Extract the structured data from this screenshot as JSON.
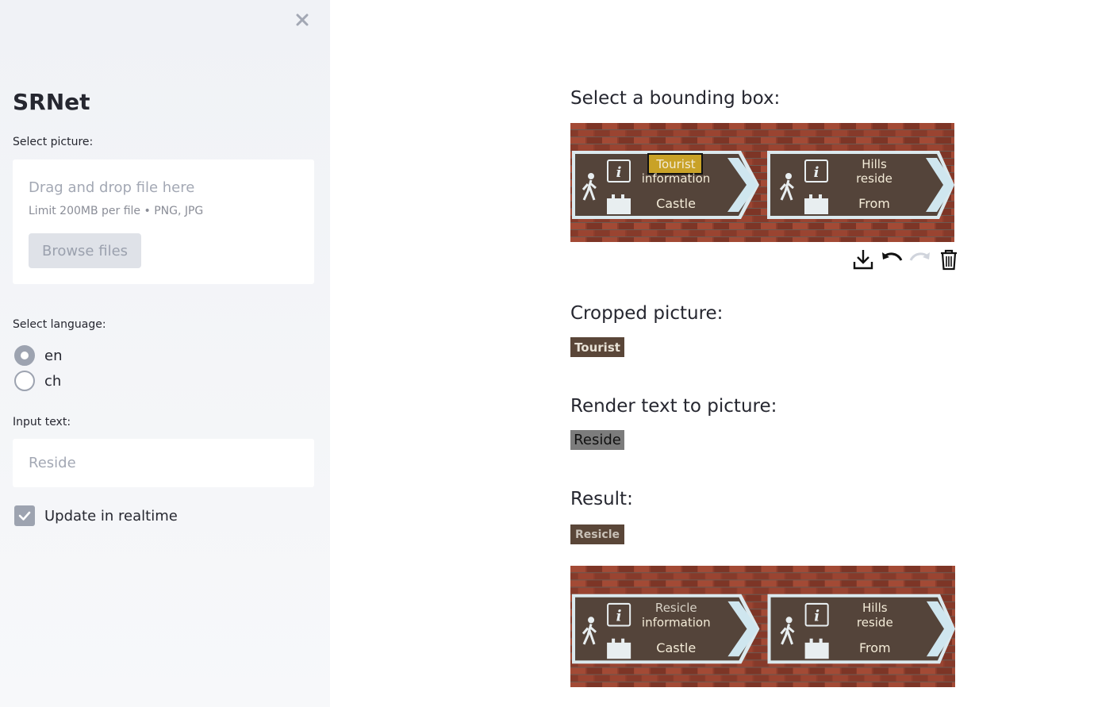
{
  "sidebar": {
    "title": "SRNet",
    "picture_label": "Select picture:",
    "dropzone": {
      "text": "Drag and drop file here",
      "limit": "Limit 200MB per file • PNG, JPG",
      "browse_label": "Browse files"
    },
    "language_label": "Select language:",
    "languages": [
      {
        "label": "en",
        "selected": true
      },
      {
        "label": "ch",
        "selected": false
      }
    ],
    "input_label": "Input text:",
    "input_placeholder": "Reside",
    "realtime_label": "Update in realtime",
    "realtime_checked": true
  },
  "main": {
    "bbox_heading": "Select a bounding box:",
    "cropped_heading": "Cropped picture:",
    "cropped_text": "Tourist",
    "render_heading": "Render text to picture:",
    "render_text": "Reside",
    "result_heading": "Result:",
    "result_text": "Resicle",
    "original_sign": {
      "left_line1": "Tourist",
      "left_line2": "information",
      "left_line3": "Castle",
      "right_line1": "Hills",
      "right_line2": "reside",
      "right_line3": "From"
    },
    "result_sign": {
      "left_line1": "Resicle",
      "left_line2": "information",
      "left_line3": "Castle",
      "right_line1": "Hills",
      "right_line2": "reside",
      "right_line3": "From"
    },
    "toolbar_icons": [
      "download-icon",
      "undo-icon",
      "redo-icon",
      "trash-icon"
    ]
  },
  "colors": {
    "sidebar_bg": "#f0f2f6",
    "sign_brown": "#54443a",
    "brick": "#8a3a2a",
    "highlight": "#c9a227"
  }
}
